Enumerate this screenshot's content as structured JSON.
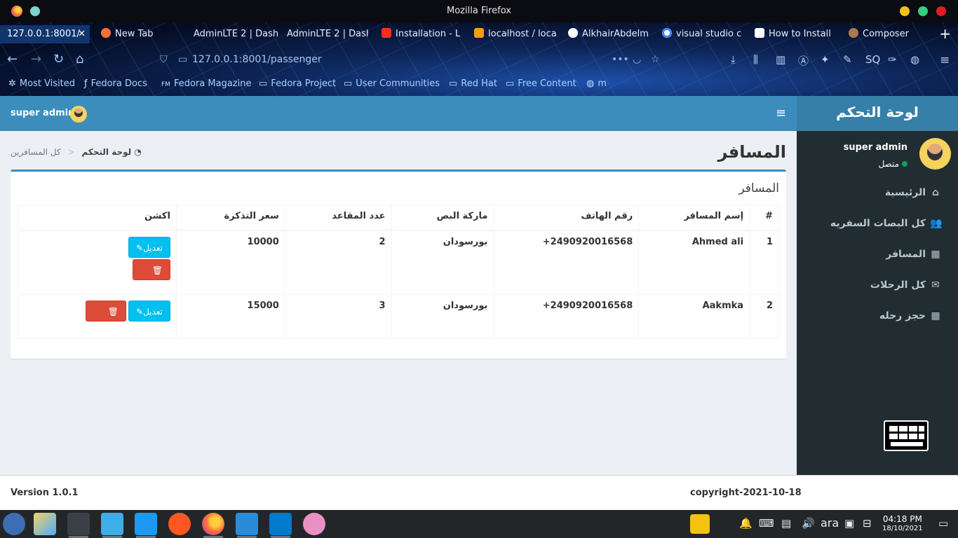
{
  "window": {
    "title": "Mozilla Firefox"
  },
  "tabs": [
    {
      "label": "127.0.0.1:8001/",
      "active": true
    },
    {
      "label": "New Tab"
    },
    {
      "label": "AdminLTE 2 | Dash"
    },
    {
      "label": "AdminLTE 2 | Dash"
    },
    {
      "label": "Installation - L"
    },
    {
      "label": "localhost / loca"
    },
    {
      "label": "AlkhairAbdelm"
    },
    {
      "label": "visual studio c"
    },
    {
      "label": "How to Install"
    },
    {
      "label": "Composer"
    }
  ],
  "nav": {
    "url": "127.0.0.1:8001/passenger"
  },
  "bookmarks": [
    {
      "label": "Most Visited",
      "icon": "gear-icon"
    },
    {
      "label": "Fedora Docs",
      "icon": "fedora-icon"
    },
    {
      "label": "Fedora Magazine",
      "icon": "fm-icon"
    },
    {
      "label": "Fedora Project",
      "icon": "folder-icon"
    },
    {
      "label": "User Communities",
      "icon": "folder-icon"
    },
    {
      "label": "Red Hat",
      "icon": "folder-icon"
    },
    {
      "label": "Free Content",
      "icon": "folder-icon"
    },
    {
      "label": "m",
      "icon": "globe-icon"
    }
  ],
  "app": {
    "logo": "لوحة التحكم",
    "topbar_user": "super admin",
    "sidebar": {
      "user_name": "super admin",
      "status": "متصل",
      "menu": [
        {
          "label": "الرئيسية",
          "icon": "home-icon"
        },
        {
          "label": "كل البصات السفريه",
          "icon": "users-icon"
        },
        {
          "label": "المسافر",
          "icon": "building-icon"
        },
        {
          "label": "كل الرحلات",
          "icon": "envelope-icon"
        },
        {
          "label": "حجز رحله",
          "icon": "grid-icon"
        }
      ]
    },
    "page_title": "المسافر",
    "breadcrumb": {
      "home": "لوحة التحكم",
      "current": "كل المسافرين"
    },
    "box_title": "المسافر",
    "table": {
      "headers": [
        "#",
        "إسم المسافر",
        "رقم الهاتف",
        "ماركة البص",
        "عدد المقاعد",
        "سعر التذكرة",
        "اكشن"
      ],
      "rows": [
        {
          "num": "1",
          "name": "Ahmed ali",
          "phone": "+2490920016568",
          "bus": "بورسودان",
          "seats": "2",
          "price": "10000"
        },
        {
          "num": "2",
          "name": "Aakmka",
          "phone": "+2490920016568",
          "bus": "بورسودان",
          "seats": "3",
          "price": "15000"
        }
      ],
      "edit_label": "تعديل",
      "delete_label": "حذف"
    },
    "footer": {
      "version": "Version 1.0.1",
      "copyright": "copyright-2021-10-18"
    }
  },
  "taskbar": {
    "language": "ara",
    "time": "04:18 PM",
    "date": "18/10/2021"
  }
}
